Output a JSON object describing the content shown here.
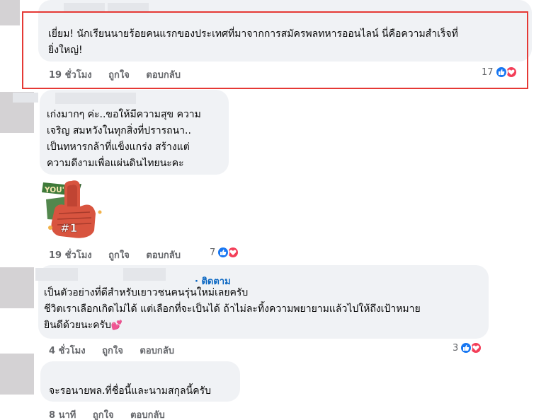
{
  "comments": [
    {
      "lines": [
        "เยี่ยม! นักเรียนนายร้อยคนแรกของประเทศที่มาจากการสมัครพลทหารออนไลน์ นี่คือความสำเร็จที่",
        "ยิ่งใหญ่!"
      ],
      "time": "19 ชั่วโมง",
      "like": "ถูกใจ",
      "reply": "ตอบกลับ",
      "reactions": "17"
    },
    {
      "lines": [
        "เก่งมากๆ ค่ะ..ขอให้มีความสุข ความ",
        "เจริญ สมหวังในทุกสิ่งที่ปรารถนา..",
        "เป็นทหารกล้าที่แข็งแกร่ง สร้างแต่",
        "ความดีงามเพื่อแผ่นดินไทยนะคะ"
      ],
      "sticker": {
        "top": "YOU'RE",
        "badge": "#1"
      },
      "time": "19 ชั่วโมง",
      "like": "ถูกใจ",
      "reply": "ตอบกลับ",
      "reactions": "7"
    },
    {
      "follow": "· ติดตาม",
      "lines": [
        "เป็นตัวอย่างที่ดีสำหรับเยาวชนคนรุ่นใหม่เลยครับ",
        "ชีวิตเราเลือกเกิดไม่ได้ แต่เลือกที่จะเป็นได้ ถ้าไม่ละทิ้งความพยายามแล้วไปให้ถึงเป้าหมาย",
        "ยินดีด้วยนะครับ"
      ],
      "emoji": "💕",
      "time": "4 ชั่วโมง",
      "like": "ถูกใจ",
      "reply": "ตอบกลับ",
      "reactions": "3"
    },
    {
      "lines": [
        "จะรอนายพล.ที่ชื่อนี้และนามสกุลนี้ครับ"
      ],
      "time": "8 นาที",
      "like": "ถูกใจ",
      "reply": "ตอบกลับ"
    }
  ]
}
